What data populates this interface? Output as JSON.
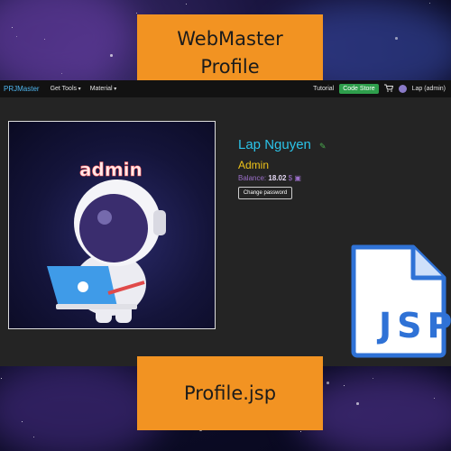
{
  "banners": {
    "top": [
      "WebMaster",
      "Profile"
    ],
    "bottom": "Profile.jsp"
  },
  "navbar": {
    "brand": "PRJMaster",
    "menus": [
      "Get Tools",
      "Material"
    ],
    "tutorial_label": "Tutorial",
    "code_store_label": "Code Store",
    "cart_icon": "cart-icon",
    "user_label": "Lap (admin)"
  },
  "profile": {
    "image_caption": "admin",
    "name": "Lap Nguyen",
    "role": "Admin",
    "balance_label": "Balance:",
    "balance_value": "18.02",
    "balance_unit": "$",
    "change_password_label": "Change password"
  },
  "badge_text": "JSP",
  "colors": {
    "banner": "#f29322",
    "name": "#2bc3e8",
    "role": "#f0c419",
    "balance": "#9b6fc8",
    "code_store": "#2e9e4c",
    "jsp_blue": "#2f72d6"
  }
}
